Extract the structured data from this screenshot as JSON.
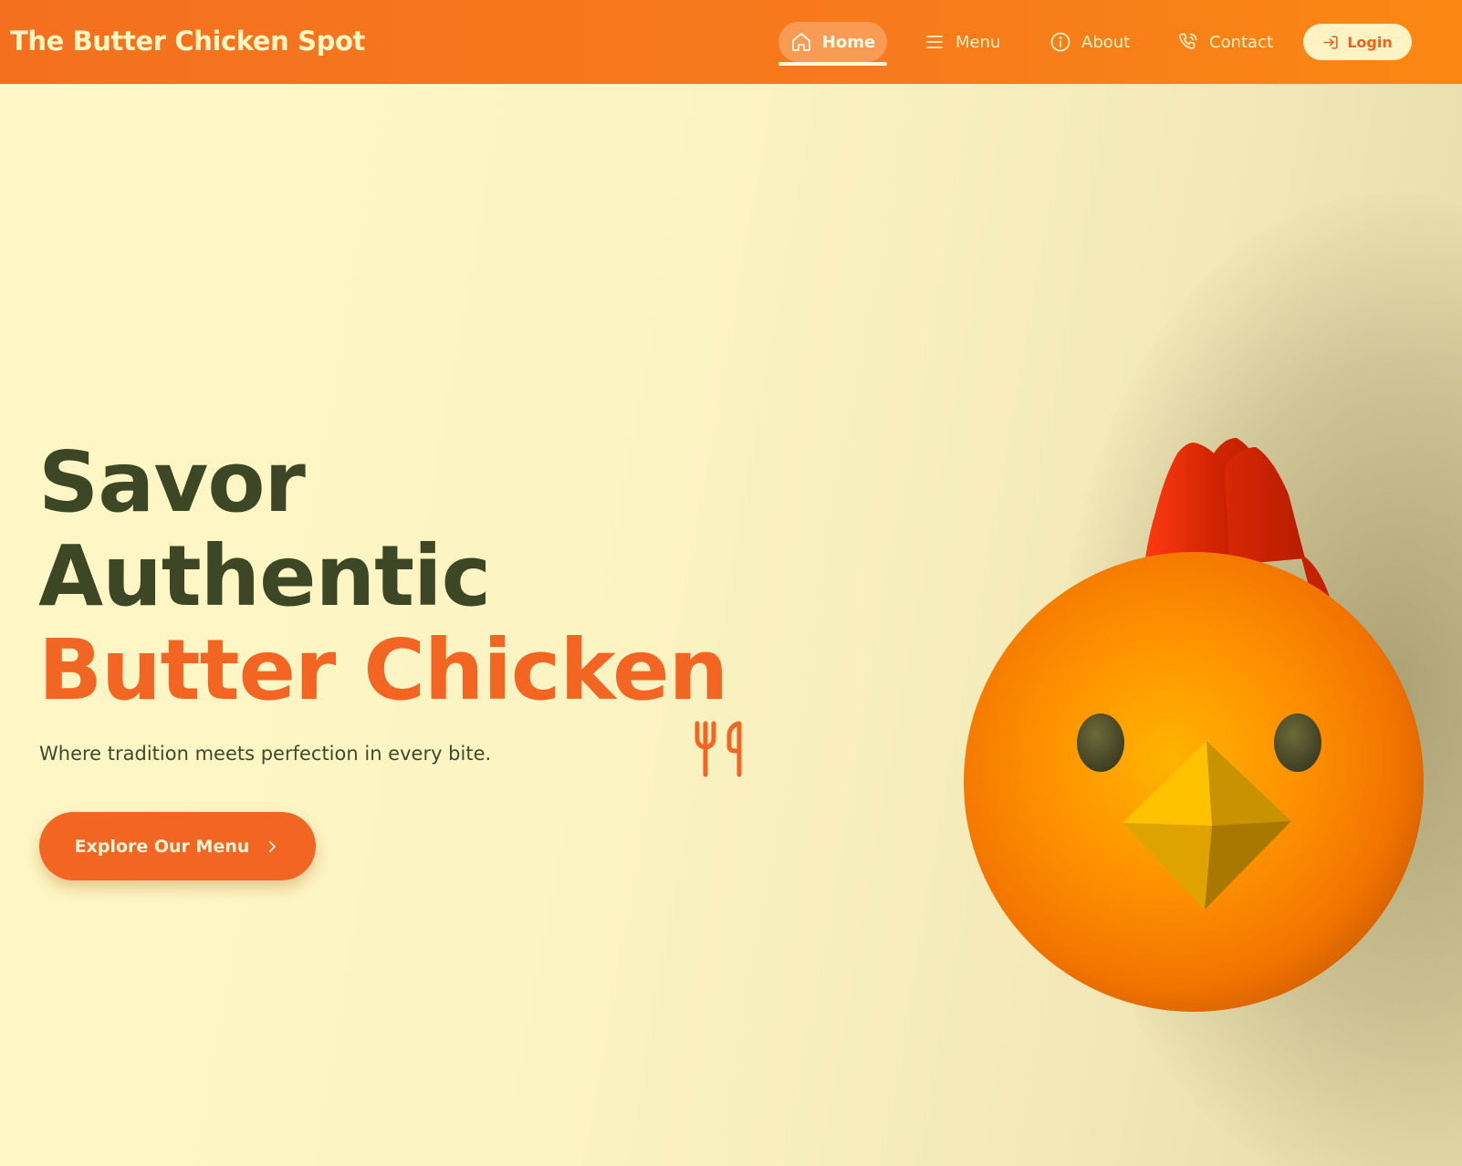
{
  "brand": {
    "name": "The Butter Chicken Spot"
  },
  "nav": {
    "items": [
      {
        "label": "Home",
        "icon": "home-icon",
        "active": true
      },
      {
        "label": "Menu",
        "icon": "menu-icon",
        "active": false
      },
      {
        "label": "About",
        "icon": "info-icon",
        "active": false
      },
      {
        "label": "Contact",
        "icon": "phone-icon",
        "active": false
      }
    ],
    "login": {
      "label": "Login",
      "icon": "login-icon"
    }
  },
  "hero": {
    "headline_line1": "Savor",
    "headline_line2": "Authentic",
    "headline_line3": "Butter Chicken",
    "headline_icon": "utensils-icon",
    "tagline": "Where tradition meets perfection in every bite.",
    "cta": {
      "label": "Explore Our Menu",
      "icon": "chevron-right-icon"
    },
    "mascot": "chicken-mascot"
  },
  "colors": {
    "header_bg": "#f77a1c",
    "accent": "#f26522",
    "dark_text": "#3d4725",
    "hero_bg": "#fff8c6",
    "login_bg": "#fff3c4"
  }
}
